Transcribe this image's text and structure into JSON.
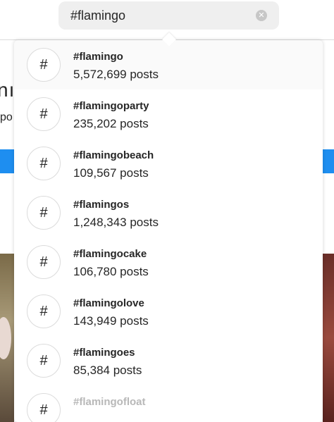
{
  "search": {
    "value": "#flamingo",
    "clear_icon": "clear-circle-icon"
  },
  "background": {
    "title_fragment": "nı",
    "sub_fragment": "po"
  },
  "results": [
    {
      "icon": "#",
      "name": "#flamingo",
      "count": "5,572,699 posts"
    },
    {
      "icon": "#",
      "name": "#flamingoparty",
      "count": "235,202 posts"
    },
    {
      "icon": "#",
      "name": "#flamingobeach",
      "count": "109,567 posts"
    },
    {
      "icon": "#",
      "name": "#flamingos",
      "count": "1,248,343 posts"
    },
    {
      "icon": "#",
      "name": "#flamingocake",
      "count": "106,780 posts"
    },
    {
      "icon": "#",
      "name": "#flamingolove",
      "count": "143,949 posts"
    },
    {
      "icon": "#",
      "name": "#flamingoes",
      "count": "85,384 posts"
    },
    {
      "icon": "#",
      "name": "#flamingofloat",
      "count": ""
    }
  ],
  "colors": {
    "accent_blue": "#1e8ef0",
    "text": "#262626",
    "search_bg": "#efefef"
  }
}
